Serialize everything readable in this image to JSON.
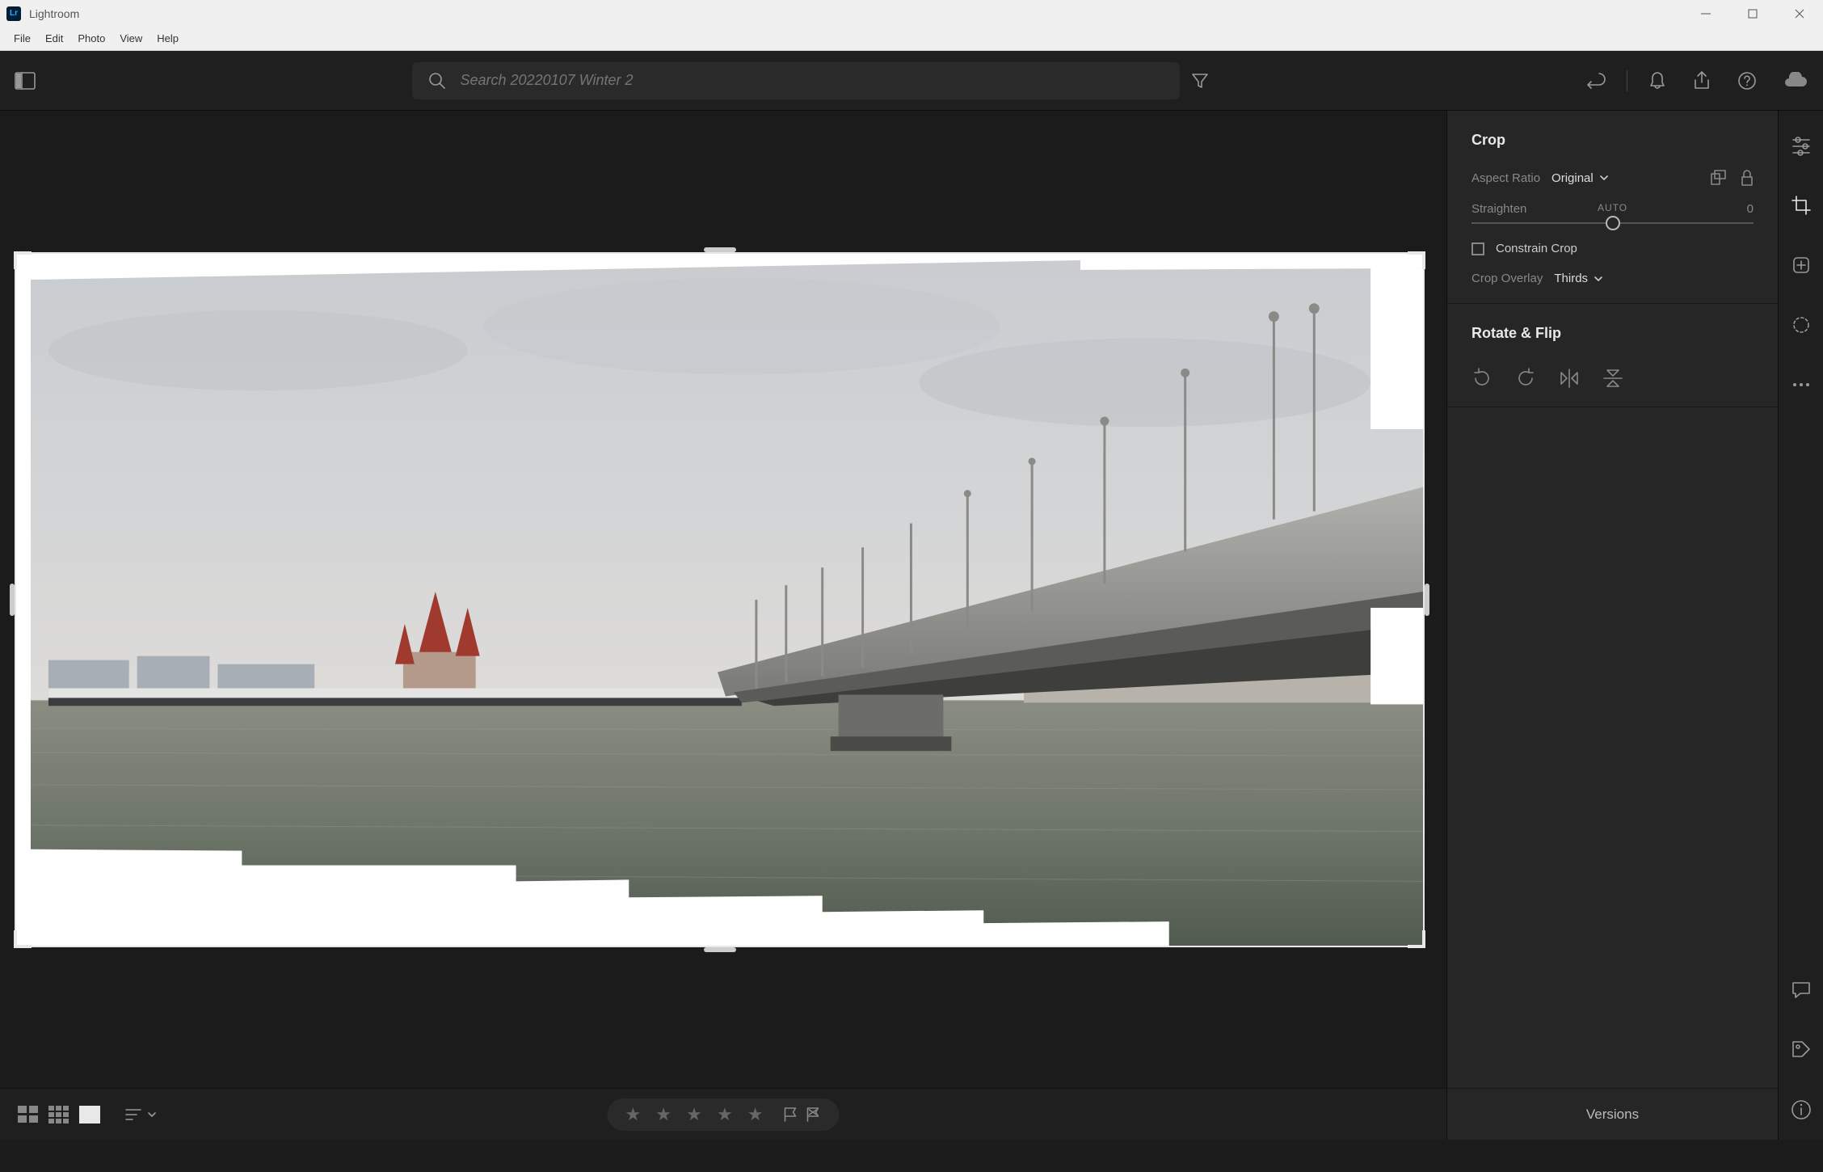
{
  "app": {
    "title": "Lightroom"
  },
  "menu": {
    "items": [
      "File",
      "Edit",
      "Photo",
      "View",
      "Help"
    ]
  },
  "search": {
    "placeholder": "Search 20220107 Winter 2"
  },
  "crop_panel": {
    "title": "Crop",
    "aspect_label": "Aspect Ratio",
    "aspect_value": "Original",
    "straighten_label": "Straighten",
    "straighten_auto": "AUTO",
    "straighten_value": "0",
    "constrain_label": "Constrain Crop",
    "overlay_label": "Crop Overlay",
    "overlay_value": "Thirds"
  },
  "rotate_panel": {
    "title": "Rotate & Flip"
  },
  "versions_label": "Versions"
}
